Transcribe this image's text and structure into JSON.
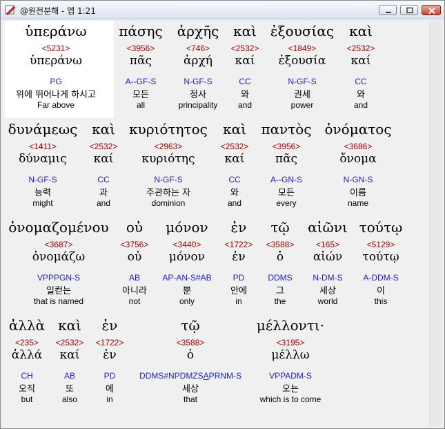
{
  "window": {
    "title": "@원전분해 - 엡 1:21",
    "colors": {
      "strong": "#a00000",
      "parse": "#1f1fc8",
      "text": "#000000"
    }
  },
  "rows": [
    {
      "words": [
        {
          "greek": "ὑπεράνω",
          "strong": "<5231>",
          "lexeme": "ὑπεράνω",
          "parsing": "PG",
          "korean": "위에 뛰어나게 하시고",
          "english": "Far above"
        },
        {
          "greek": "πάσης",
          "strong": "<3956>",
          "lexeme": "πᾶς",
          "parsing": "A--GF-S",
          "korean": "모든",
          "english": "all"
        },
        {
          "greek": "ἀρχῆς",
          "strong": "<746>",
          "lexeme": "ἀρχή",
          "parsing": "N-GF-S",
          "korean": "정사",
          "english": "principality"
        },
        {
          "greek": "καὶ",
          "strong": "<2532>",
          "lexeme": "καί",
          "parsing": "CC",
          "korean": "와",
          "english": "and"
        },
        {
          "greek": "ἐξουσίας",
          "strong": "<1849>",
          "lexeme": "ἐξουσία",
          "parsing": "N-GF-S",
          "korean": "권세",
          "english": "power"
        },
        {
          "greek": "καὶ",
          "strong": "<2532>",
          "lexeme": "καί",
          "parsing": "CC",
          "korean": "와",
          "english": "and"
        }
      ]
    },
    {
      "words": [
        {
          "greek": "δυνάμεως",
          "strong": "<1411>",
          "lexeme": "δύναμις",
          "parsing": "N-GF-S",
          "korean": "능력",
          "english": "might"
        },
        {
          "greek": "καὶ",
          "strong": "<2532>",
          "lexeme": "καί",
          "parsing": "CC",
          "korean": "과",
          "english": "and"
        },
        {
          "greek": "κυριότητος",
          "strong": "<2963>",
          "lexeme": "κυριότης",
          "parsing": "N-GF-S",
          "korean": "주관하는 자",
          "english": "dominion"
        },
        {
          "greek": "καὶ",
          "strong": "<2532>",
          "lexeme": "καί",
          "parsing": "CC",
          "korean": "와",
          "english": "and"
        },
        {
          "greek": "παντὸς",
          "strong": "<3956>",
          "lexeme": "πᾶς",
          "parsing": "A--GN-S",
          "korean": "모든",
          "english": "every"
        },
        {
          "greek": "ὀνόματος",
          "strong": "<3686>",
          "lexeme": "ὄνομα",
          "parsing": "N-GN-S",
          "korean": "이름",
          "english": "name"
        }
      ]
    },
    {
      "words": [
        {
          "greek": "ὀνομαζομένου",
          "strong": "<3687>",
          "lexeme": "ὀνομάζω",
          "parsing": "VPPPGN-S",
          "korean": "일컫는",
          "english": "that is named"
        },
        {
          "greek": "οὐ",
          "strong": "<3756>",
          "lexeme": "οὐ",
          "parsing": "AB",
          "korean": "아니라",
          "english": "not"
        },
        {
          "greek": "μόνον",
          "strong": "<3440>",
          "lexeme": "μόνον",
          "parsing": "AP-AN-S#AB",
          "korean": "뿐",
          "english": "only"
        },
        {
          "greek": "ἐν",
          "strong": "<1722>",
          "lexeme": "ἐν",
          "parsing": "PD",
          "korean": "안에",
          "english": "in"
        },
        {
          "greek": "τῷ",
          "strong": "<3588>",
          "lexeme": "ὁ",
          "parsing": "DDMS",
          "korean": "그",
          "english": "the"
        },
        {
          "greek": "αἰῶνι",
          "strong": "<165>",
          "lexeme": "αἰών",
          "parsing": "N-DM-S",
          "korean": "세상",
          "english": "world"
        },
        {
          "greek": "τούτῳ",
          "strong": "<5129>",
          "lexeme": "τούτῳ",
          "parsing": "A-DDM-S",
          "korean": "이",
          "english": "this"
        }
      ]
    },
    {
      "words": [
        {
          "greek": "ἀλλὰ",
          "strong": "<235>",
          "lexeme": "ἀλλά",
          "parsing": "CH",
          "korean": "오직",
          "english": "but"
        },
        {
          "greek": "καὶ",
          "strong": "<2532>",
          "lexeme": "καί",
          "parsing": "AB",
          "korean": "또",
          "english": "also"
        },
        {
          "greek": "ἐν",
          "strong": "<1722>",
          "lexeme": "ἐν",
          "parsing": "PD",
          "korean": "에",
          "english": "in"
        },
        {
          "greek": "τῷ",
          "strong": "<3588>",
          "lexeme": "ὁ",
          "parsing": "DDMS#NPDMZS",
          "parsing_underlined": "A",
          "parsing_tail": "PRNM-S",
          "korean": "세상",
          "english": "that"
        },
        {
          "greek": "μέλλοντι·",
          "strong": "<3195>",
          "lexeme": "μέλλω",
          "parsing": "VPPADM-S",
          "korean": "오는",
          "english": "which is to come"
        }
      ]
    }
  ]
}
